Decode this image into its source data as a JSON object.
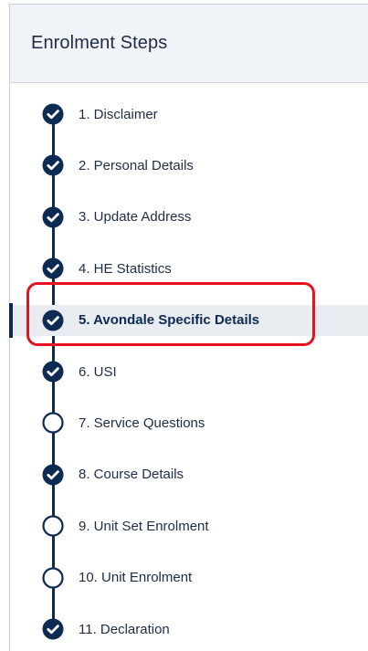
{
  "panel": {
    "title": "Enrolment Steps"
  },
  "steps": [
    {
      "label": "1. Disclaimer",
      "status": "complete",
      "icon": "check-circle-icon"
    },
    {
      "label": "2. Personal Details",
      "status": "complete",
      "icon": "check-circle-icon"
    },
    {
      "label": "3. Update Address",
      "status": "complete",
      "icon": "check-circle-icon"
    },
    {
      "label": "4. HE Statistics",
      "status": "complete",
      "icon": "check-circle-icon"
    },
    {
      "label": "5. Avondale Specific Details",
      "status": "current",
      "icon": "check-circle-icon"
    },
    {
      "label": "6. USI",
      "status": "complete",
      "icon": "check-circle-icon"
    },
    {
      "label": "7. Service Questions",
      "status": "incomplete",
      "icon": "empty-circle-icon"
    },
    {
      "label": "8. Course Details",
      "status": "complete",
      "icon": "check-circle-icon"
    },
    {
      "label": "9. Unit Set Enrolment",
      "status": "incomplete",
      "icon": "empty-circle-icon"
    },
    {
      "label": "10. Unit Enrolment",
      "status": "incomplete",
      "icon": "empty-circle-icon"
    },
    {
      "label": "11. Declaration",
      "status": "complete",
      "icon": "check-circle-icon"
    }
  ],
  "colors": {
    "navy": "#0d2b52",
    "highlight_red": "#e4131e",
    "header_bg": "#f0f3f7",
    "active_bg": "#e9ecf1"
  }
}
